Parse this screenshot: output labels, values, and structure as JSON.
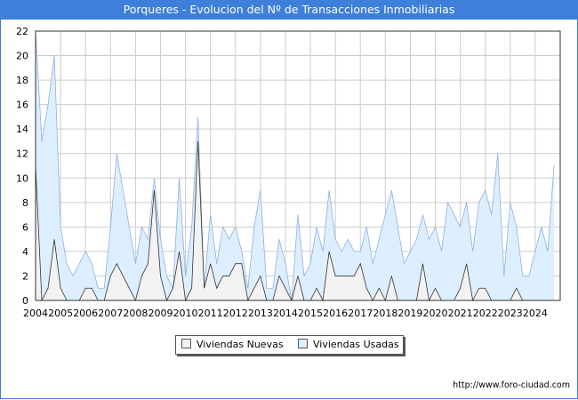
{
  "title": "Porqueres - Evolucion del Nº de Transacciones Inmobiliarias",
  "footer_url": "http://www.foro-ciudad.com",
  "colors": {
    "title_bg": "#3d7fd9",
    "nuevas_fill": "#f2f2f2",
    "nuevas_line": "#333333",
    "usadas_fill": "#ddeeff",
    "usadas_line": "#8fb1dd"
  },
  "chart_data": {
    "type": "area",
    "title": "Porqueres - Evolucion del Nº de Transacciones Inmobiliarias",
    "xlabel": "",
    "ylabel": "",
    "x_start": "2004-Q1",
    "x_ticks": [
      "2004",
      "2005",
      "2006",
      "2007",
      "2008",
      "2009",
      "2010",
      "2011",
      "2012",
      "2013",
      "2014",
      "2015",
      "2016",
      "2017",
      "2018",
      "2019",
      "2020",
      "2021",
      "2022",
      "2023",
      "2024"
    ],
    "ylim": [
      0,
      22
    ],
    "y_ticks": [
      0,
      2,
      4,
      6,
      8,
      10,
      12,
      14,
      16,
      18,
      20,
      22
    ],
    "grid": true,
    "legend_position": "bottom-center",
    "series": [
      {
        "name": "Viviendas Nuevas",
        "values": [
          11,
          0,
          1,
          5,
          1,
          0,
          0,
          0,
          1,
          1,
          0,
          0,
          2,
          3,
          2,
          1,
          0,
          2,
          3,
          9,
          2,
          0,
          1,
          4,
          0,
          1,
          13,
          1,
          3,
          1,
          2,
          2,
          3,
          3,
          0,
          1,
          2,
          0,
          0,
          2,
          1,
          0,
          2,
          0,
          0,
          1,
          0,
          4,
          2,
          2,
          2,
          2,
          3,
          1,
          0,
          1,
          0,
          2,
          0,
          0,
          0,
          0,
          3,
          0,
          1,
          0,
          0,
          0,
          1,
          3,
          0,
          1,
          1,
          0,
          0,
          0,
          0,
          1,
          0,
          0,
          0,
          0,
          0,
          0,
          0
        ]
      },
      {
        "name": "Viviendas Usadas",
        "values": [
          22,
          13,
          16,
          20,
          6,
          3,
          2,
          3,
          4,
          3,
          1,
          1,
          6,
          12,
          9,
          6,
          3,
          6,
          5,
          10,
          5,
          2,
          1,
          10,
          2,
          6,
          15,
          1,
          7,
          3,
          6,
          5,
          6,
          4,
          1,
          6,
          9,
          1,
          1,
          5,
          3,
          0,
          7,
          2,
          3,
          6,
          4,
          9,
          5,
          4,
          5,
          4,
          4,
          6,
          3,
          5,
          7,
          9,
          6,
          3,
          4,
          5,
          7,
          5,
          6,
          4,
          8,
          7,
          6,
          8,
          4,
          8,
          9,
          7,
          12,
          2,
          8,
          6,
          2,
          2,
          4,
          6,
          4,
          11
        ]
      }
    ]
  }
}
